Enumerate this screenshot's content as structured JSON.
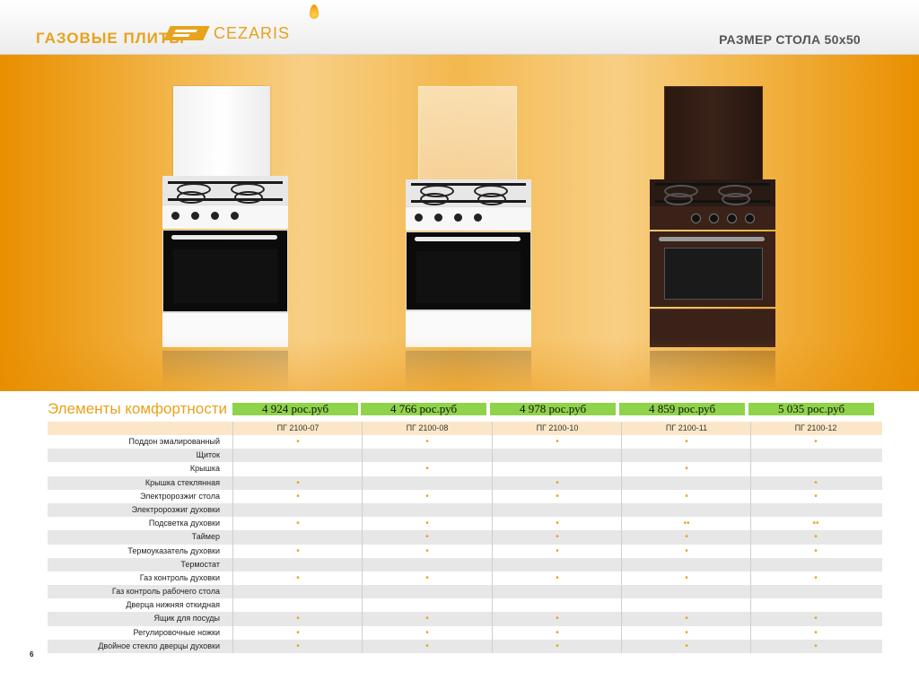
{
  "header": {
    "title": "ГАЗОВЫЕ ПЛИТЫ",
    "brand": "CEZARIS",
    "size_label": "РАЗМЕР СТОЛА 50х50"
  },
  "products": [
    {
      "price": "4 924 рос.руб",
      "model": "ПГ 2100-07",
      "color": "white-white-lid"
    },
    {
      "price": "4 766 рос.руб",
      "model": "ПГ 2100-08",
      "color": "white-glass-lid"
    },
    {
      "price": "4 978 рос.руб",
      "model": "ПГ 2100-10",
      "color": "none"
    },
    {
      "price": "4 859 рос.руб",
      "model": "ПГ 2100-11",
      "color": "none"
    },
    {
      "price": "5 035 рос.руб",
      "model": "ПГ 2100-12",
      "color": "brown"
    }
  ],
  "table": {
    "title": "Элементы комфортности",
    "rows": [
      {
        "label": "Поддон эмалированный",
        "marks": [
          "•",
          "•",
          "•",
          "•",
          "•"
        ]
      },
      {
        "label": "Щиток",
        "marks": [
          "",
          "",
          "",
          "",
          ""
        ]
      },
      {
        "label": "Крышка",
        "marks": [
          "",
          "•",
          "",
          "•",
          ""
        ]
      },
      {
        "label": "Крышка стеклянная",
        "marks": [
          "•",
          "",
          "•",
          "",
          "•"
        ]
      },
      {
        "label": "Электророзжиг стола",
        "marks": [
          "•",
          "•",
          "•",
          "•",
          "•"
        ]
      },
      {
        "label": "Электророзжиг духовки",
        "marks": [
          "",
          "",
          "",
          "",
          ""
        ]
      },
      {
        "label": "Подсветка духовки",
        "marks": [
          "•",
          "•",
          "•",
          "••",
          "••"
        ]
      },
      {
        "label": "Таймер",
        "marks": [
          "",
          "•",
          "•",
          "•",
          "•"
        ]
      },
      {
        "label": "Термоуказатель духовки",
        "marks": [
          "•",
          "•",
          "•",
          "•",
          "•"
        ]
      },
      {
        "label": "Термостат",
        "marks": [
          "",
          "",
          "",
          "",
          ""
        ]
      },
      {
        "label": "Газ контроль духовки",
        "marks": [
          "•",
          "•",
          "•",
          "•",
          "•"
        ]
      },
      {
        "label": "Газ контроль рабочего стола",
        "marks": [
          "",
          "",
          "",
          "",
          ""
        ]
      },
      {
        "label": "Дверца нижняя откидная",
        "marks": [
          "",
          "",
          "",
          "",
          ""
        ]
      },
      {
        "label": "Ящик для посуды",
        "marks": [
          "•",
          "•",
          "•",
          "•",
          "•"
        ]
      },
      {
        "label": "Регулировочные ножки",
        "marks": [
          "•",
          "•",
          "•",
          "•",
          "•"
        ]
      },
      {
        "label": "Двойное стекло дверцы духовки",
        "marks": [
          "•",
          "•",
          "•",
          "•",
          "•"
        ]
      }
    ]
  },
  "page_number": "6",
  "colors": {
    "accent": "#e8a21c",
    "price_bg": "#8fd34a",
    "alt_row": "#e7e7e7",
    "model_row": "#fbe7c7"
  }
}
